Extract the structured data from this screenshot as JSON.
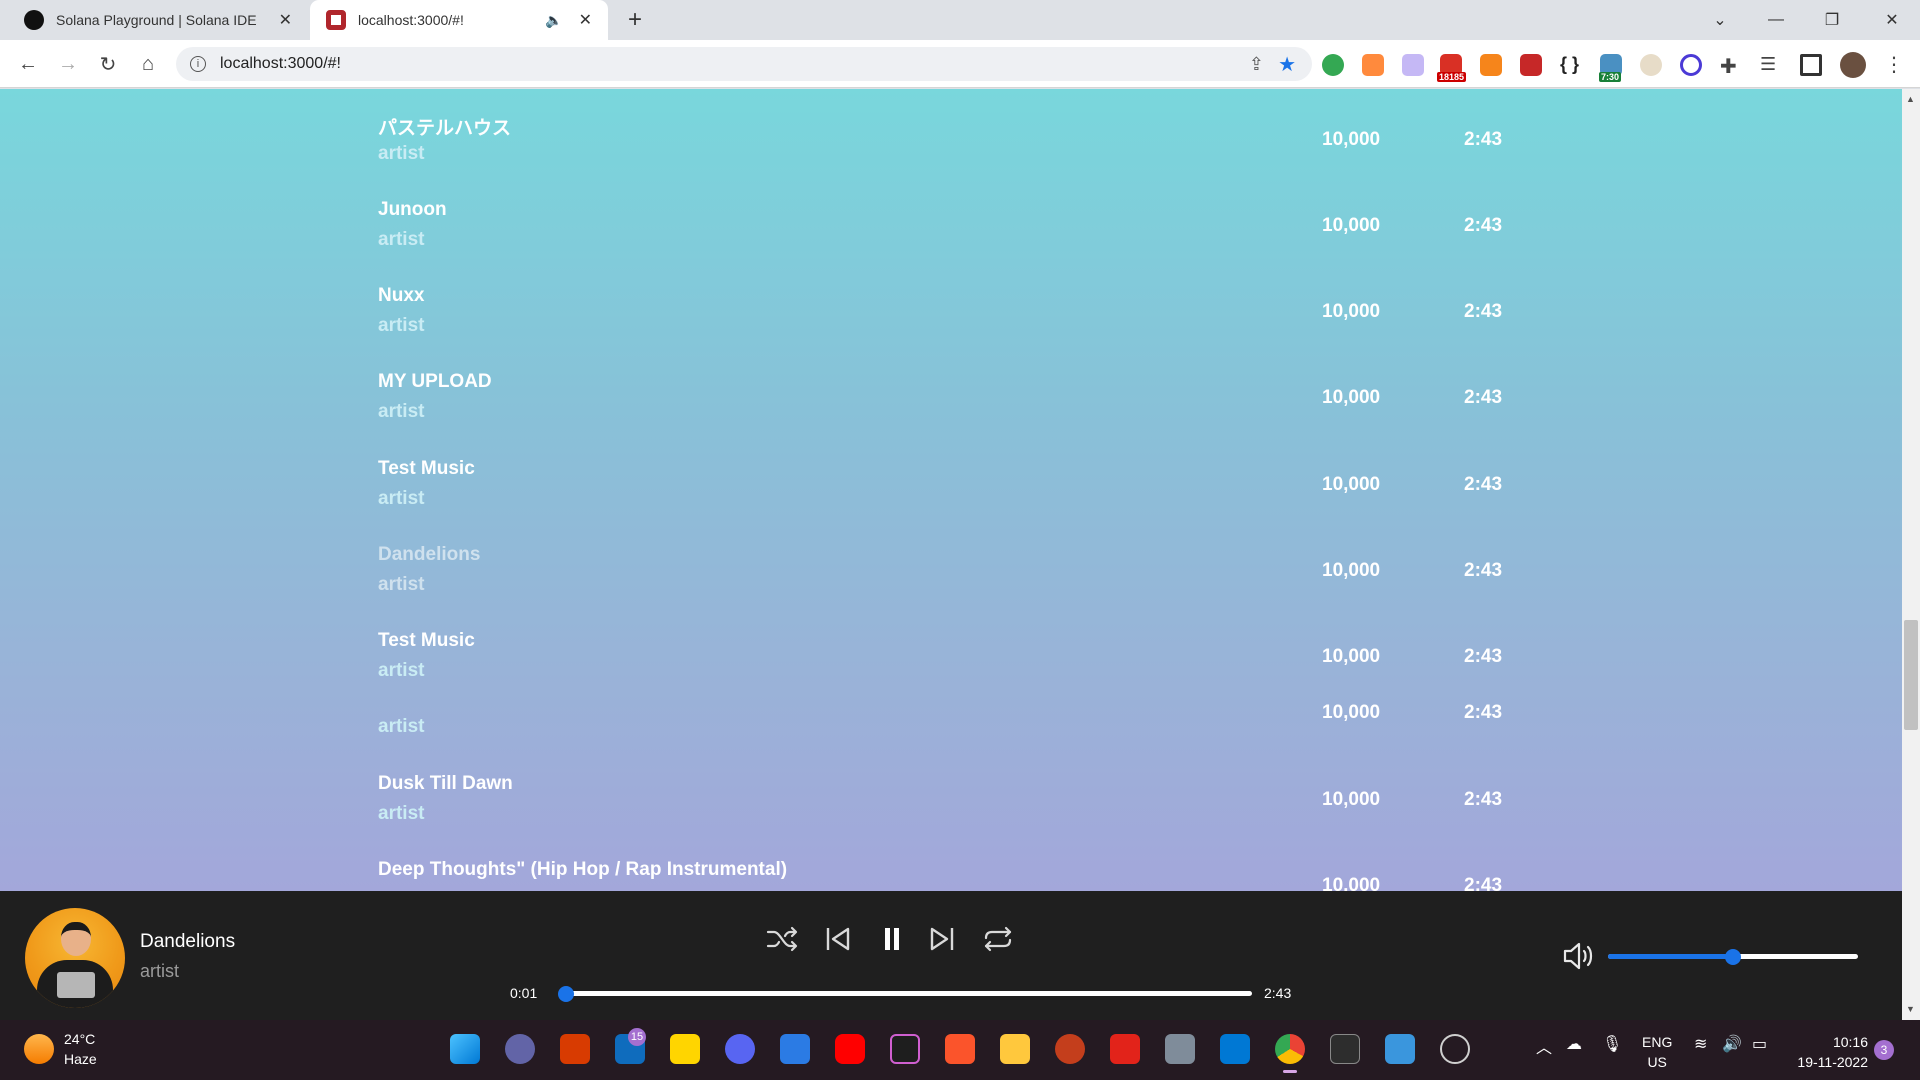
{
  "browser": {
    "tabs": [
      {
        "title": "Solana Playground | Solana IDE",
        "close": "✕"
      },
      {
        "title": "localhost:3000/#!",
        "close": "✕"
      }
    ],
    "new_tab": "+",
    "window": {
      "dropdown": "⌄",
      "minimize": "—",
      "restore": "❐",
      "close": "✕"
    },
    "nav": {
      "back": "←",
      "forward": "→",
      "reload": "↻",
      "home": "⌂"
    },
    "address": "localhost:3000/#!",
    "extension_badges": {
      "mail_count": "18185",
      "timer": "7:30"
    }
  },
  "songs": [
    {
      "name": "パステルハウス",
      "artist": "artist",
      "plays": "10,000",
      "duration": "2:43"
    },
    {
      "name": "Junoon",
      "artist": "artist",
      "plays": "10,000",
      "duration": "2:43"
    },
    {
      "name": "Nuxx",
      "artist": "artist",
      "plays": "10,000",
      "duration": "2:43"
    },
    {
      "name": "MY UPLOAD",
      "artist": "artist",
      "plays": "10,000",
      "duration": "2:43"
    },
    {
      "name": "Test Music",
      "artist": "artist",
      "plays": "10,000",
      "duration": "2:43"
    },
    {
      "name": "Dandelions",
      "artist": "artist",
      "plays": "10,000",
      "duration": "2:43"
    },
    {
      "name": "Test Music",
      "artist": "artist",
      "plays": "10,000",
      "duration": "2:43"
    },
    {
      "name": "",
      "artist": "artist",
      "plays": "10,000",
      "duration": "2:43"
    },
    {
      "name": "Dusk Till Dawn",
      "artist": "artist",
      "plays": "10,000",
      "duration": "2:43"
    },
    {
      "name": "Deep Thoughts\" (Hip Hop / Rap Instrumental)",
      "artist": "artist",
      "plays": "10,000",
      "duration": "2:43"
    }
  ],
  "player": {
    "title": "Dandelions",
    "artist": "artist",
    "elapsed": "0:01",
    "total": "2:43",
    "progress_fraction": 0.006,
    "volume_fraction": 0.5,
    "accent": "#1a73e8"
  },
  "taskbar": {
    "weather_temp": "24°C",
    "weather_desc": "Haze",
    "mail_badge": "15",
    "lang_line1": "ENG",
    "lang_line2": "US",
    "time": "10:16",
    "date": "19-11-2022",
    "notifications": "3"
  }
}
